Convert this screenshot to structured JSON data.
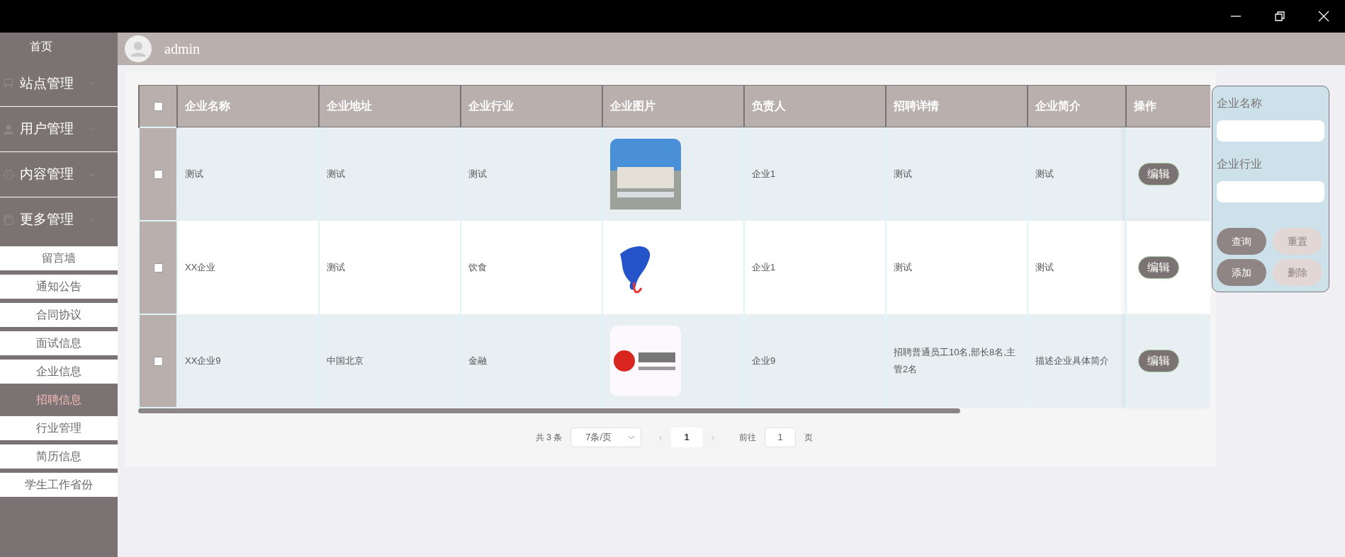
{
  "sidebar": {
    "home": "首页",
    "groups": [
      {
        "label": "站点管理",
        "expanded": false
      },
      {
        "label": "用户管理",
        "expanded": false
      },
      {
        "label": "内容管理",
        "expanded": false
      },
      {
        "label": "更多管理",
        "expanded": true,
        "children": [
          {
            "label": "留言墙",
            "selected": false
          },
          {
            "label": "通知公告",
            "selected": false
          },
          {
            "label": "合同协议",
            "selected": false
          },
          {
            "label": "面试信息",
            "selected": false
          },
          {
            "label": "企业信息",
            "selected": false
          },
          {
            "label": "招聘信息",
            "selected": true
          },
          {
            "label": "行业管理",
            "selected": false
          },
          {
            "label": "简历信息",
            "selected": false
          },
          {
            "label": "学生工作省份",
            "selected": false
          }
        ]
      }
    ]
  },
  "header": {
    "user": "admin"
  },
  "table": {
    "columns": [
      "企业名称",
      "企业地址",
      "企业行业",
      "企业图片",
      "负责人",
      "招聘详情",
      "企业简介",
      "操作"
    ],
    "select_all_checked": false,
    "rows": [
      {
        "checked": false,
        "name": "测试",
        "address": "测试",
        "industry": "测试",
        "owner": "企业1",
        "detail": "测试",
        "intro": "测试",
        "action": "编辑"
      },
      {
        "checked": false,
        "name": "XX企业",
        "address": "测试",
        "industry": "饮食",
        "owner": "企业1",
        "detail": "测试",
        "intro": "测试",
        "action": "编辑"
      },
      {
        "checked": false,
        "name": "XX企业9",
        "address": "中国北京",
        "industry": "金融",
        "owner": "企业9",
        "detail": "招聘普通员工10名,部长8名,主管2名",
        "intro": "描述企业具体简介",
        "action": "编辑"
      }
    ]
  },
  "pagination": {
    "total": "共 3 条",
    "page_size": "7条/页",
    "prev": "‹",
    "next": "›",
    "pages": [
      {
        "label": "1",
        "selected": true
      }
    ],
    "goto_label": "前往",
    "goto_value": "1",
    "page_unit": "页"
  },
  "search_panel": {
    "fields": [
      {
        "label": "企业名称"
      },
      {
        "label": "企业行业"
      }
    ],
    "buttons": [
      {
        "label": "查询",
        "disabled": false
      },
      {
        "label": "重置",
        "disabled": true
      },
      {
        "label": "添加",
        "disabled": false
      },
      {
        "label": "删除",
        "disabled": true
      }
    ]
  }
}
